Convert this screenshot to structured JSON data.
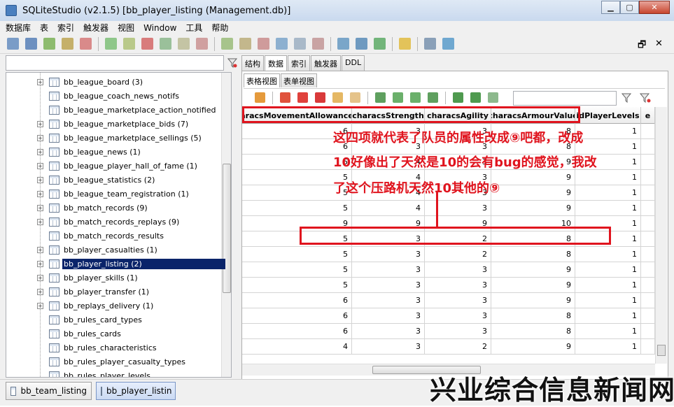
{
  "window": {
    "title": "SQLiteStudio (v2.1.5) [bb_player_listing (Management.db)]",
    "minimize_icon": "minimize-icon",
    "maximize_icon": "maximize-icon",
    "close_icon": "close-icon",
    "mdi_restore": "🗗",
    "mdi_close": "✕"
  },
  "menubar": {
    "items": [
      "数据库",
      "表",
      "索引",
      "触发器",
      "视图",
      "Window",
      "工具",
      "帮助"
    ]
  },
  "sidebar": {
    "items": [
      {
        "label": "bb_league_board  (3)",
        "expandable": true
      },
      {
        "label": "bb_league_coach_news_notifs",
        "expandable": false
      },
      {
        "label": "bb_league_marketplace_action_notified",
        "expandable": false
      },
      {
        "label": "bb_league_marketplace_bids  (7)",
        "expandable": true
      },
      {
        "label": "bb_league_marketplace_sellings  (5)",
        "expandable": true
      },
      {
        "label": "bb_league_news  (1)",
        "expandable": true
      },
      {
        "label": "bb_league_player_hall_of_fame  (1)",
        "expandable": true
      },
      {
        "label": "bb_league_statistics  (2)",
        "expandable": true
      },
      {
        "label": "bb_league_team_registration  (1)",
        "expandable": true
      },
      {
        "label": "bb_match_records  (9)",
        "expandable": true
      },
      {
        "label": "bb_match_records_replays  (9)",
        "expandable": true
      },
      {
        "label": "bb_match_records_results",
        "expandable": false
      },
      {
        "label": "bb_player_casualties  (1)",
        "expandable": true
      },
      {
        "label": "bb_player_listing  (2)",
        "expandable": true,
        "selected": true
      },
      {
        "label": "bb_player_skills  (1)",
        "expandable": true
      },
      {
        "label": "bb_player_transfer  (1)",
        "expandable": true
      },
      {
        "label": "bb_replays_delivery  (1)",
        "expandable": true
      },
      {
        "label": "bb_rules_card_types",
        "expandable": false
      },
      {
        "label": "bb_rules_cards",
        "expandable": false
      },
      {
        "label": "bb_rules_characteristics",
        "expandable": false
      },
      {
        "label": "bb_rules_player_casualty_types",
        "expandable": false
      },
      {
        "label": "bb_rules_player_levels",
        "expandable": false
      }
    ]
  },
  "editor": {
    "tabs": [
      "结构",
      "数据",
      "索引",
      "触发器",
      "DDL"
    ],
    "active_tab": "数据",
    "subtabs": [
      "表格视图",
      "表单视图"
    ],
    "active_subtab": "表格视图"
  },
  "grid": {
    "columns": [
      "aracsMovementAllowance",
      "characsStrength",
      "characsAgility",
      "characsArmourValue",
      "idPlayerLevels",
      "e"
    ],
    "rows": [
      [
        "6",
        "3",
        "3",
        "8",
        "1",
        ""
      ],
      [
        "6",
        "3",
        "3",
        "8",
        "1",
        ""
      ],
      [
        "5",
        "4",
        "3",
        "9",
        "1",
        ""
      ],
      [
        "5",
        "4",
        "3",
        "9",
        "1",
        ""
      ],
      [
        "5",
        "4",
        "3",
        "9",
        "1",
        ""
      ],
      [
        "5",
        "4",
        "3",
        "9",
        "1",
        ""
      ],
      [
        "9",
        "9",
        "9",
        "10",
        "1",
        ""
      ],
      [
        "5",
        "3",
        "2",
        "8",
        "1",
        ""
      ],
      [
        "5",
        "3",
        "2",
        "8",
        "1",
        ""
      ],
      [
        "5",
        "3",
        "3",
        "9",
        "1",
        ""
      ],
      [
        "5",
        "3",
        "3",
        "9",
        "1",
        ""
      ],
      [
        "6",
        "3",
        "3",
        "9",
        "1",
        ""
      ],
      [
        "6",
        "3",
        "3",
        "8",
        "1",
        ""
      ],
      [
        "6",
        "3",
        "3",
        "8",
        "1",
        ""
      ],
      [
        "4",
        "3",
        "2",
        "9",
        "1",
        ""
      ]
    ]
  },
  "annotation": {
    "line1": "这四项就代表了队员的属性改成⑨吧都，改成",
    "line2": "10好像出了天然是10的会有bug的感觉，我改",
    "line3": "了这个压路机天然10其他的⑨",
    "color": "#e0141e"
  },
  "bottom_tabs": [
    {
      "label": "bb_team_listing",
      "active": false
    },
    {
      "label": "bb_player_listin",
      "active": true
    }
  ],
  "watermark": "兴业综合信息新闻网",
  "colors": {
    "selection": "#0a246a",
    "annotation_red": "#e0141e"
  }
}
